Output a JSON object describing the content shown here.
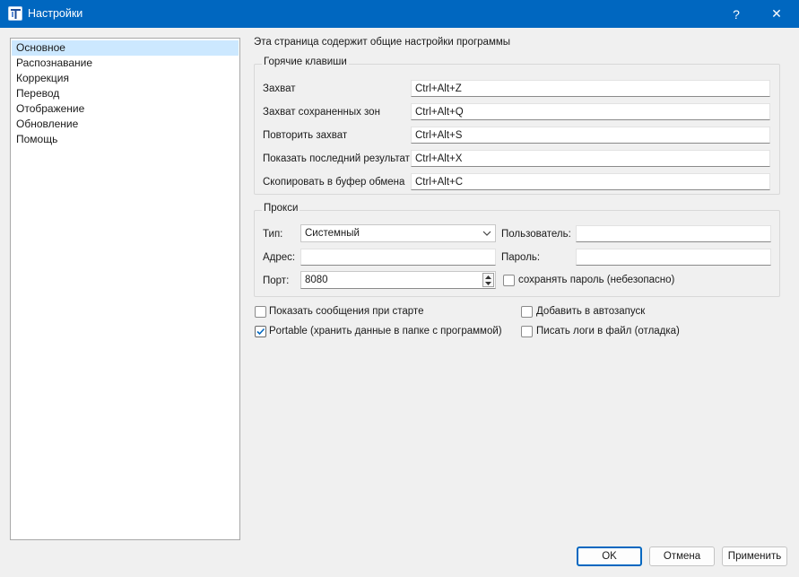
{
  "window": {
    "title": "Настройки",
    "help_label": "?",
    "close_label": "✕",
    "app_icon": "app-icon"
  },
  "nav": {
    "items": [
      {
        "label": "Основное",
        "selected": true
      },
      {
        "label": "Распознавание",
        "selected": false
      },
      {
        "label": "Коррекция",
        "selected": false
      },
      {
        "label": "Перевод",
        "selected": false
      },
      {
        "label": "Отображение",
        "selected": false
      },
      {
        "label": "Обновление",
        "selected": false
      },
      {
        "label": "Помощь",
        "selected": false
      }
    ]
  },
  "page": {
    "description": "Эта страница содержит общие настройки программы"
  },
  "hotkeys": {
    "title": "Горячие клавиши",
    "items": [
      {
        "label": "Захват",
        "value": "Ctrl+Alt+Z"
      },
      {
        "label": "Захват сохраненных зон",
        "value": "Ctrl+Alt+Q"
      },
      {
        "label": "Повторить захват",
        "value": "Ctrl+Alt+S"
      },
      {
        "label": "Показать последний результат",
        "value": "Ctrl+Alt+X"
      },
      {
        "label": "Скопировать в буфер обмена",
        "value": "Ctrl+Alt+C"
      }
    ]
  },
  "proxy": {
    "title": "Прокси",
    "type_label": "Тип:",
    "type_value": "Системный",
    "address_label": "Адрес:",
    "address_value": "",
    "port_label": "Порт:",
    "port_value": "8080",
    "user_label": "Пользователь:",
    "user_value": "",
    "password_label": "Пароль:",
    "password_value": "",
    "save_password_label": "сохранять пароль (небезопасно)",
    "save_password_checked": false
  },
  "options": {
    "show_messages_label": "Показать сообщения при старте",
    "show_messages_checked": false,
    "portable_label": "Portable (хранить данные в папке с программой)",
    "portable_checked": true,
    "autostart_label": "Добавить в автозапуск",
    "autostart_checked": false,
    "write_logs_label": "Писать логи в файл (отладка)",
    "write_logs_checked": false
  },
  "buttons": {
    "ok": "OK",
    "cancel": "Отмена",
    "apply": "Применить"
  },
  "colors": {
    "titlebar": "#0067c0",
    "selection": "#cce8ff",
    "accent": "#0067c0"
  }
}
